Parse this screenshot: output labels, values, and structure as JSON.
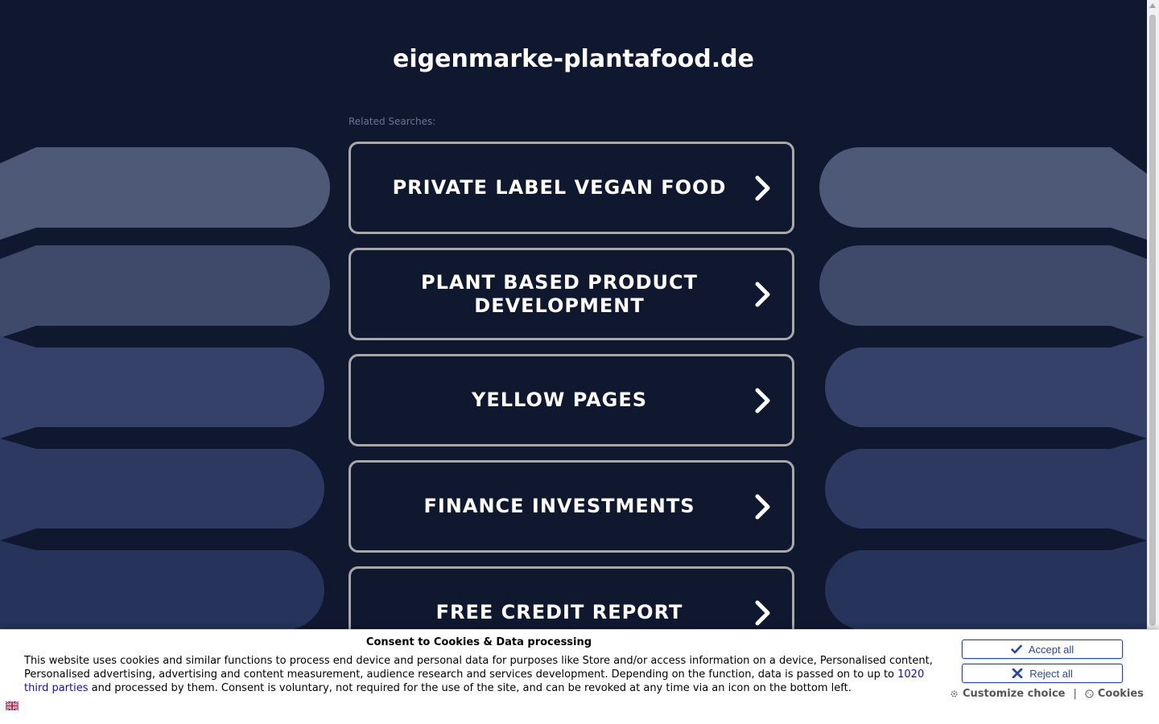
{
  "page": {
    "site_title": "eigenmarke-plantafood.de",
    "related_label": "Related Searches:"
  },
  "searches": [
    {
      "label": "PRIVATE LABEL VEGAN FOOD"
    },
    {
      "label": "PLANT BASED PRODUCT DEVELOPMENT"
    },
    {
      "label": "YELLOW PAGES"
    },
    {
      "label": "FINANCE INVESTMENTS"
    },
    {
      "label": "FREE CREDIT REPORT"
    }
  ],
  "consent": {
    "title": "Consent to Cookies & Data processing",
    "text_before_link": "This website uses cookies and similar functions to process end device and personal data for purposes like Store and/or access information on a device, Personalised content, Personalised advertising, advertising and content measurement, audience research and services development. Depending on the function, data is passed on to up to ",
    "link_text": "1020 third parties",
    "text_after_link": " and processed by them. Consent is voluntary, not required for the use of the site, and can be revoked at any time via an icon on the bottom left.",
    "accept_label": "Accept all",
    "reject_label": "Reject all",
    "customize_label": "Customize choice",
    "separator": "|",
    "cookies_label": "Cookies"
  },
  "colors": {
    "background": "#101830",
    "button_border": "#a8a8a8",
    "consent_accent": "#2846a2",
    "link": "#1a0dab"
  },
  "icons": {
    "chevron": "chevron-right-icon",
    "accept": "check-icon",
    "reject": "x-icon",
    "customize": "gear-icon",
    "cookies": "cookie-icon",
    "language": "flag-uk-icon"
  }
}
